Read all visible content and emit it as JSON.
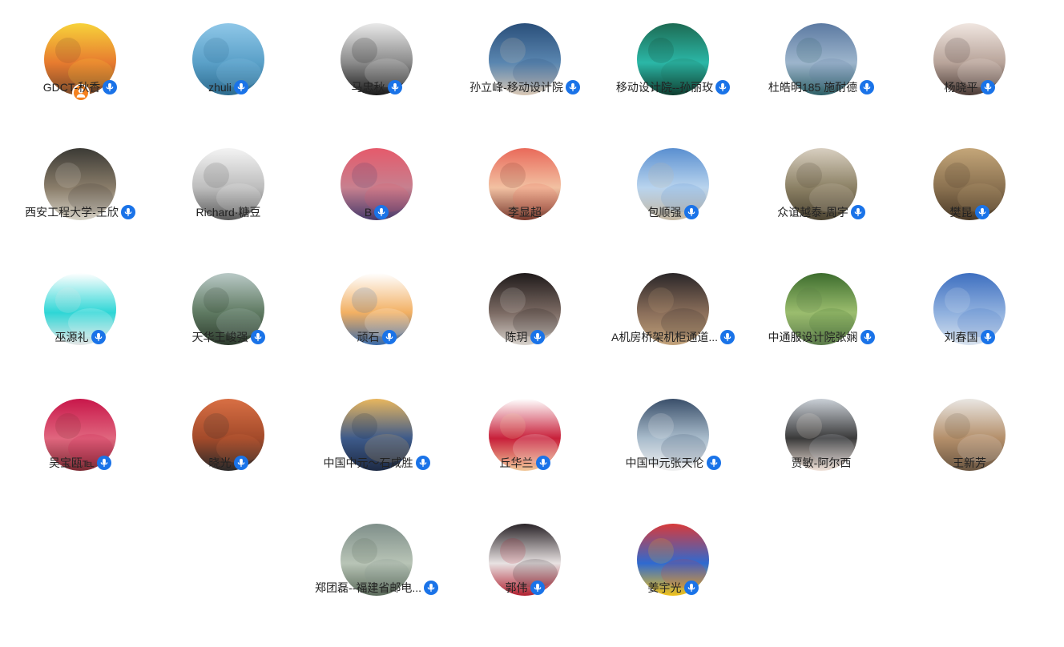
{
  "participants": [
    {
      "name": "GDCT-秋香",
      "mic": true,
      "host": true,
      "avatar": "flowers-dog-photo",
      "bg": [
        "#f7d23a",
        "#e77b2f",
        "#7a4a2a"
      ]
    },
    {
      "name": "zhuli",
      "mic": true,
      "avatar": "sailboat-sea-photo",
      "bg": [
        "#8fc7e8",
        "#5aa0c8",
        "#2d6b8e"
      ]
    },
    {
      "name": "马忠秋",
      "mic": true,
      "avatar": "portrait-bw-photo",
      "bg": [
        "#e9e9e9",
        "#8a8a8a",
        "#1a1a1a"
      ]
    },
    {
      "name": "孙立峰-移动设计院",
      "mic": true,
      "avatar": "coastline-photo",
      "bg": [
        "#2a4f7a",
        "#5a86b0",
        "#d9c7b4"
      ]
    },
    {
      "name": "移动设计院--孙丽玫",
      "mic": true,
      "avatar": "river-forest-photo",
      "bg": [
        "#1d6b53",
        "#2bb7a7",
        "#0e3b2d"
      ]
    },
    {
      "name": "杜皓明185 施耐德",
      "mic": true,
      "avatar": "lake-boat-photo",
      "bg": [
        "#5c7aa2",
        "#9db5cc",
        "#2d5f66"
      ]
    },
    {
      "name": "杨晓平",
      "mic": true,
      "avatar": "cat-photo",
      "bg": [
        "#f0e6e0",
        "#b8a49a",
        "#4a3a35"
      ]
    },
    {
      "name": "西安工程大学-王欣",
      "mic": true,
      "avatar": "forest-person-photo",
      "bg": [
        "#3b3a35",
        "#8a7d6a",
        "#d6d2c6"
      ]
    },
    {
      "name": "Richard·糖豆",
      "mic": false,
      "avatar": "person-cat-bw-photo",
      "bg": [
        "#f3f3f3",
        "#bdbdbd",
        "#5a5a5a"
      ]
    },
    {
      "name": "B",
      "mic": true,
      "avatar": "moon-sunset-photo",
      "bg": [
        "#e55a6b",
        "#c7808f",
        "#473a6b"
      ]
    },
    {
      "name": "李显超",
      "mic": false,
      "avatar": "baby-photo",
      "bg": [
        "#e96a5a",
        "#f2c1a2",
        "#7a3a2e"
      ]
    },
    {
      "name": "包顺强",
      "mic": true,
      "avatar": "harbor-photo",
      "bg": [
        "#5a8fd0",
        "#b9d4ee",
        "#c4b7a0"
      ]
    },
    {
      "name": "众谊越泰-周宇",
      "mic": true,
      "avatar": "trees-couple-photo",
      "bg": [
        "#d8cfc0",
        "#8b8064",
        "#4c4432"
      ]
    },
    {
      "name": "樊昆",
      "mic": true,
      "avatar": "rock-wall-photo",
      "bg": [
        "#c4a679",
        "#8a7150",
        "#4a3a28"
      ]
    },
    {
      "name": "巫源礼",
      "mic": true,
      "avatar": "wl-logo",
      "bg": [
        "#ffffff",
        "#2ed6d6",
        "#e6e6e6"
      ]
    },
    {
      "name": "天华王峻强",
      "mic": true,
      "avatar": "mountains-photo",
      "bg": [
        "#b9c9c6",
        "#5f7a62",
        "#2d3b2d"
      ]
    },
    {
      "name": "顽石",
      "mic": true,
      "avatar": "basketball-cartoon",
      "bg": [
        "#ffffff",
        "#f2b063",
        "#3a6aa8"
      ]
    },
    {
      "name": "陈玥",
      "mic": true,
      "avatar": "cafe-window-photo",
      "bg": [
        "#1f1a1a",
        "#7b6a63",
        "#d8d2cc"
      ]
    },
    {
      "name": "A机房桥架机柜通道...",
      "mic": true,
      "avatar": "woman-store-photo",
      "bg": [
        "#2a2628",
        "#8a6e5a",
        "#c2a27a"
      ]
    },
    {
      "name": "中通服设计院张娴",
      "mic": true,
      "avatar": "field-person-photo",
      "bg": [
        "#3d6d2e",
        "#9bbd6e",
        "#5a7a4a"
      ]
    },
    {
      "name": "刘春国",
      "mic": true,
      "avatar": "sky-photo",
      "bg": [
        "#3e6fc0",
        "#8fb0de",
        "#d8e2ee"
      ]
    },
    {
      "name": "吴宝瓯℡",
      "mic": true,
      "avatar": "child-pink-photo",
      "bg": [
        "#c8174a",
        "#e0667e",
        "#7a2a33"
      ]
    },
    {
      "name": "晓光",
      "mic": true,
      "avatar": "man-orange-wall-photo",
      "bg": [
        "#d86f44",
        "#a34a2a",
        "#2a2a2a"
      ]
    },
    {
      "name": "中国中元～石咸胜",
      "mic": true,
      "avatar": "snow-mountain-photo",
      "bg": [
        "#e8b65e",
        "#3d5a8a",
        "#1d2a44"
      ]
    },
    {
      "name": "丘华兰",
      "mic": true,
      "avatar": "red-emblem-art",
      "bg": [
        "#ffffff",
        "#c8203a",
        "#f0c89a"
      ]
    },
    {
      "name": "中国中元张天伦",
      "mic": true,
      "avatar": "clouds-terrace-photo",
      "bg": [
        "#3a4f6a",
        "#a9bccc",
        "#f1f1f1"
      ]
    },
    {
      "name": "贾敏-阿尔西",
      "mic": false,
      "avatar": "woman-portrait-photo",
      "bg": [
        "#c9cfd6",
        "#3a3a3a",
        "#f1e3da"
      ]
    },
    {
      "name": "王新芳",
      "mic": false,
      "avatar": "lynx-snow-photo",
      "bg": [
        "#e9e6e2",
        "#b48f6a",
        "#6a5642"
      ]
    },
    {
      "name": "郑团磊--福建省邮电...",
      "mic": true,
      "avatar": "waterfall-photo",
      "bg": [
        "#7f8f8a",
        "#b8c4b6",
        "#5a6a5a"
      ]
    },
    {
      "name": "郭伟",
      "mic": true,
      "avatar": "anime-portrait-art",
      "bg": [
        "#2a2428",
        "#e8e2e2",
        "#b02030"
      ]
    },
    {
      "name": "姜宇光",
      "mic": true,
      "avatar": "balloons-photo",
      "bg": [
        "#d83a3a",
        "#2f6ad0",
        "#f1c21a"
      ]
    }
  ],
  "colors": {
    "mic_badge": "#1a73e8",
    "host_badge": "#f5811f",
    "text": "#222222"
  }
}
